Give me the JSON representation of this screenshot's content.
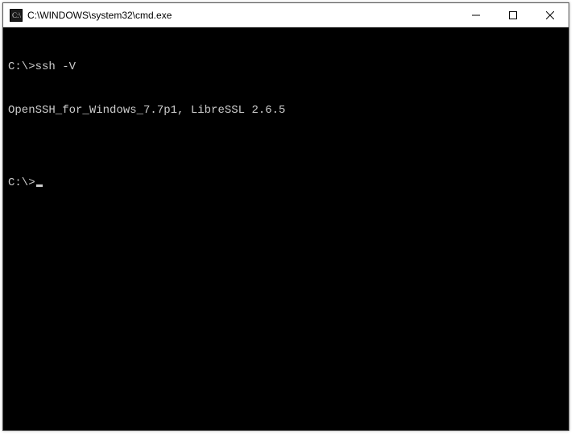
{
  "titlebar": {
    "title": "C:\\WINDOWS\\system32\\cmd.exe"
  },
  "terminal": {
    "line1_prompt": "C:\\>",
    "line1_command": "ssh -V",
    "line2_output": "OpenSSH_for_Windows_7.7p1, LibreSSL 2.6.5",
    "line3_blank": "",
    "line4_prompt": "C:\\>"
  }
}
